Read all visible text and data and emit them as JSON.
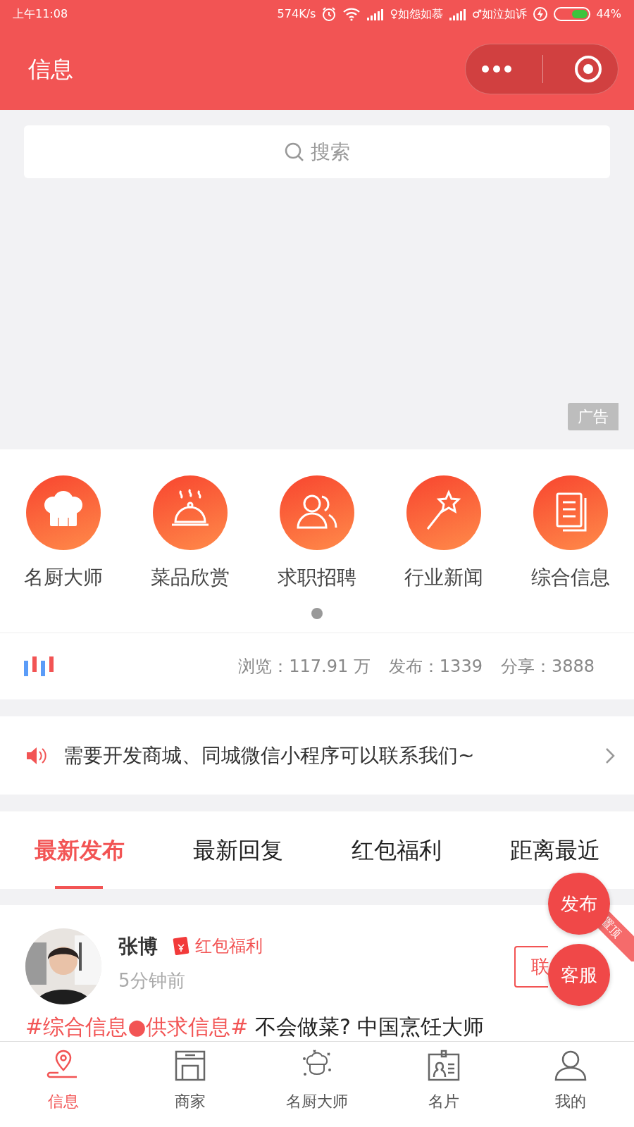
{
  "status_bar": {
    "time": "上午11:08",
    "speed": "574K/s",
    "carrier_1": "♀如怨如慕",
    "carrier_2": "♂如泣如诉",
    "battery": "44%"
  },
  "header": {
    "title": "信息"
  },
  "search": {
    "placeholder": "搜索"
  },
  "banner": {
    "ad_label": "广告"
  },
  "categories": [
    {
      "label": "名厨大师",
      "kind": "chef"
    },
    {
      "label": "菜品欣赏",
      "kind": "dish"
    },
    {
      "label": "求职招聘",
      "kind": "people"
    },
    {
      "label": "行业新闻",
      "kind": "wand"
    },
    {
      "label": "综合信息",
      "kind": "document"
    }
  ],
  "pager": [
    {
      "selected": true
    }
  ],
  "stats": [
    "浏览：117.91 万",
    "发布：1339",
    "分享：3888"
  ],
  "notice": {
    "text": "需要开发商城、同城微信小程序可以联系我们~"
  },
  "tabs": [
    {
      "label": "最新发布",
      "selected": true
    },
    {
      "label": "最新回复",
      "selected": false
    },
    {
      "label": "红包福利",
      "selected": false
    },
    {
      "label": "距离最近",
      "selected": false
    }
  ],
  "posts": [
    {
      "name": "张博",
      "tag": "红包福利",
      "time": "5分钟前",
      "contact_button": "联",
      "pinned_label": "置顶",
      "topic": "#综合信息●供求信息#",
      "text": "不会做菜? 中国烹饪大师"
    }
  ],
  "floating_buttons": [
    {
      "label": "发布"
    },
    {
      "label": "客服"
    }
  ],
  "bottom_nav": [
    {
      "label": "信息",
      "kind": "location",
      "selected": true
    },
    {
      "label": "商家",
      "kind": "shop",
      "selected": false
    },
    {
      "label": "名厨大师",
      "kind": "chef",
      "selected": false
    },
    {
      "label": "名片",
      "kind": "card",
      "selected": false
    },
    {
      "label": "我的",
      "kind": "person",
      "selected": false
    }
  ]
}
